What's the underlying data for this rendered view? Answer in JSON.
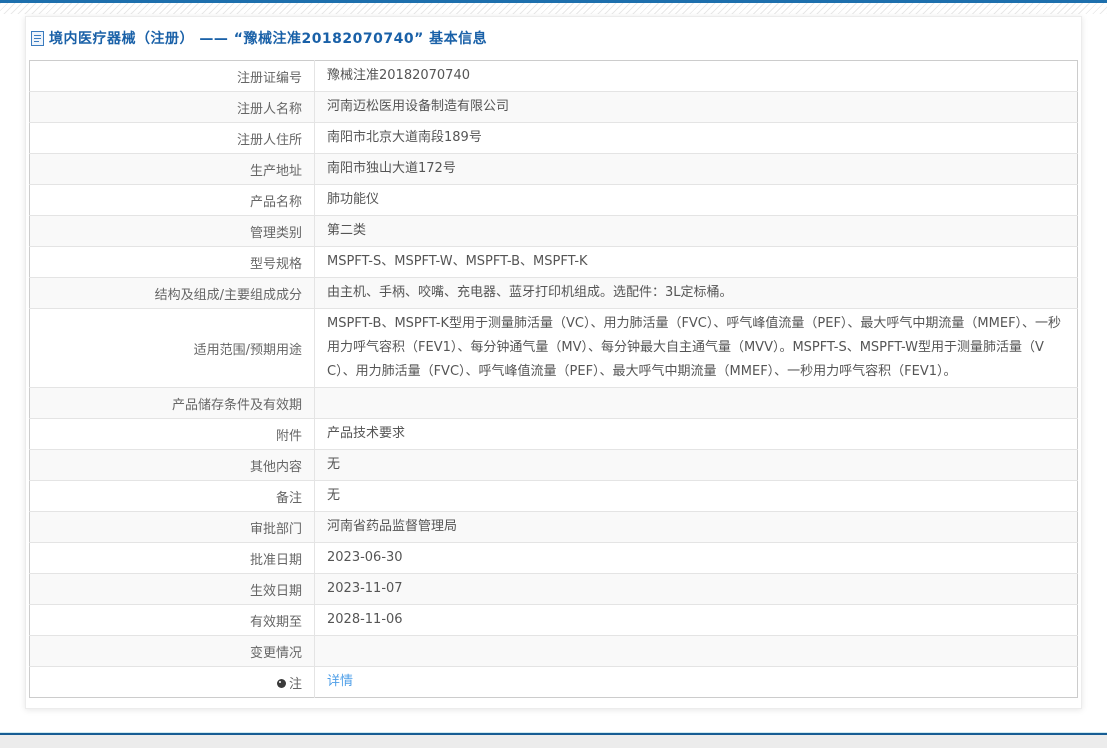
{
  "page": {
    "title": "境内医疗器械（注册） —— “豫械注准20182070740” 基本信息"
  },
  "table": {
    "rows": [
      {
        "label": "注册证编号",
        "value": "豫械注准20182070740"
      },
      {
        "label": "注册人名称",
        "value": "河南迈松医用设备制造有限公司"
      },
      {
        "label": "注册人住所",
        "value": "南阳市北京大道南段189号"
      },
      {
        "label": "生产地址",
        "value": "南阳市独山大道172号"
      },
      {
        "label": "产品名称",
        "value": "肺功能仪"
      },
      {
        "label": "管理类别",
        "value": "第二类"
      },
      {
        "label": "型号规格",
        "value": "MSPFT-S、MSPFT-W、MSPFT-B、MSPFT-K"
      },
      {
        "label": "结构及组成/主要组成成分",
        "value": "由主机、手柄、咬嘴、充电器、蓝牙打印机组成。选配件：3L定标桶。"
      },
      {
        "label": "适用范围/预期用途",
        "value": "MSPFT-B、MSPFT-K型用于测量肺活量（VC）、用力肺活量（FVC）、呼气峰值流量（PEF）、最大呼气中期流量（MMEF）、一秒用力呼气容积（FEV1）、每分钟通气量（MV）、每分钟最大自主通气量（MVV）。MSPFT-S、MSPFT-W型用于测量肺活量（VC）、用力肺活量（FVC）、呼气峰值流量（PEF）、最大呼气中期流量（MMEF）、一秒用力呼气容积（FEV1）。"
      },
      {
        "label": "产品储存条件及有效期",
        "value": ""
      },
      {
        "label": "附件",
        "value": "产品技术要求"
      },
      {
        "label": "其他内容",
        "value": "无"
      },
      {
        "label": "备注",
        "value": "无"
      },
      {
        "label": "审批部门",
        "value": "河南省药品监督管理局"
      },
      {
        "label": "批准日期",
        "value": "2023-06-30"
      },
      {
        "label": "生效日期",
        "value": "2023-11-07"
      },
      {
        "label": "有效期至",
        "value": "2028-11-06"
      },
      {
        "label": "变更情况",
        "value": ""
      },
      {
        "label": "注",
        "value": "详情",
        "link": true,
        "icon": "bulb-icon"
      }
    ]
  },
  "colors": {
    "accent_blue": "#1a61a8",
    "link_blue": "#4f9fe8",
    "top_bar_blue": "#1d6fad",
    "footer_line_blue": "#175d94",
    "footer_band_gray": "#ececec",
    "row_alt_gray": "#f9f9f9"
  }
}
